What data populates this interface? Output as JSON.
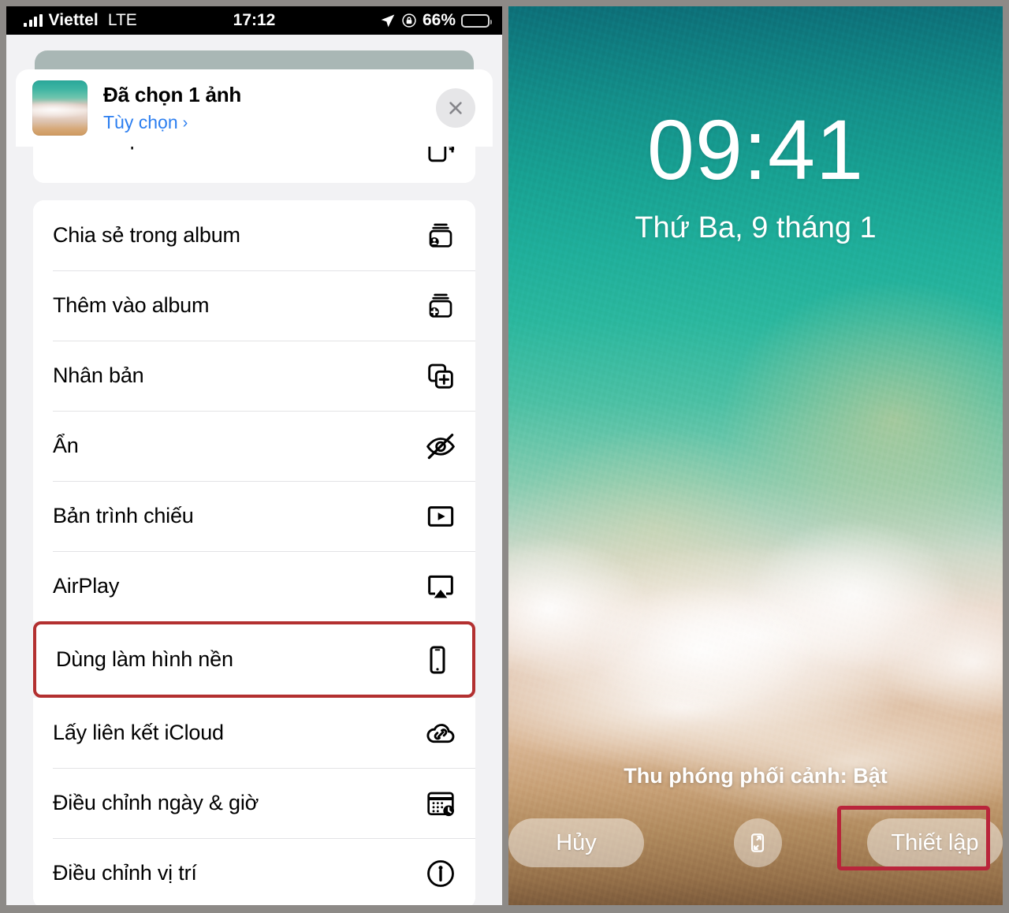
{
  "status_bar": {
    "carrier": "Viettel",
    "network": "LTE",
    "time": "17:12",
    "battery_percent": "66%",
    "battery_level": 66,
    "battery_color": "#fcd000",
    "icons": [
      "signal-bars-icon",
      "location-arrow-icon",
      "rotation-lock-icon",
      "battery-icon"
    ]
  },
  "share_sheet": {
    "title": "Đã chọn 1 ảnh",
    "options_link": "Tùy chọn",
    "options_chevron": "›",
    "close_icon": "close-icon",
    "thumbnail": "selected-photo-thumbnail",
    "groups": [
      {
        "partial": true,
        "items": [
          {
            "label": "Sao chép ảnh",
            "icon": "copy-photo-icon",
            "clipped": true,
            "highlighted": false
          }
        ]
      },
      {
        "partial": false,
        "items": [
          {
            "label": "Chia sẻ trong album",
            "icon": "shared-album-icon",
            "clipped": false,
            "highlighted": false
          },
          {
            "label": "Thêm vào album",
            "icon": "add-to-album-icon",
            "clipped": false,
            "highlighted": false
          },
          {
            "label": "Nhân bản",
            "icon": "duplicate-icon",
            "clipped": false,
            "highlighted": false
          },
          {
            "label": "Ẩn",
            "icon": "hide-eye-slash-icon",
            "clipped": false,
            "highlighted": false
          },
          {
            "label": "Bản trình chiếu",
            "icon": "slideshow-play-icon",
            "clipped": false,
            "highlighted": false
          },
          {
            "label": "AirPlay",
            "icon": "airplay-icon",
            "clipped": false,
            "highlighted": false
          },
          {
            "label": "Dùng làm hình nền",
            "icon": "use-as-wallpaper-iphone-icon",
            "clipped": false,
            "highlighted": true
          },
          {
            "label": "Lấy liên kết iCloud",
            "icon": "icloud-link-icon",
            "clipped": false,
            "highlighted": false
          },
          {
            "label": "Điều chỉnh ngày & giờ",
            "icon": "adjust-date-time-icon",
            "clipped": false,
            "highlighted": false
          },
          {
            "label": "Điều chỉnh vị trí",
            "icon": "adjust-location-icon",
            "clipped": false,
            "highlighted": false
          }
        ]
      }
    ]
  },
  "wallpaper_preview": {
    "clock": "09:41",
    "date": "Thứ Ba, 9 tháng 1",
    "perspective_zoom": "Thu phóng phối cảnh: Bật",
    "cancel_label": "Hủy",
    "set_label": "Thiết lập",
    "scale_icon": "perspective-scale-icon"
  },
  "annotations": {
    "highlight_color": "#b33030",
    "setup_highlight_color": "#b9253b"
  }
}
